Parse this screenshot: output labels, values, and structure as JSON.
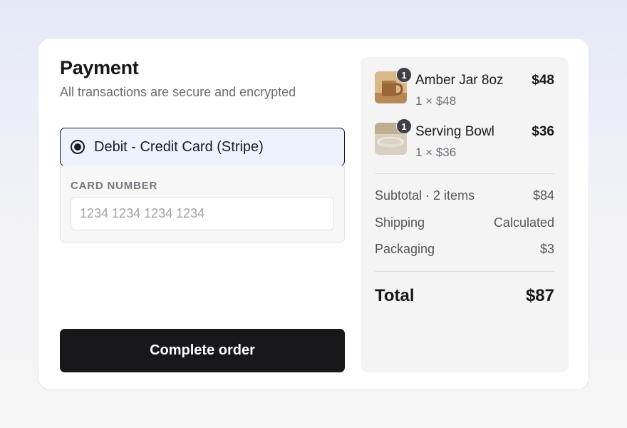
{
  "payment": {
    "title": "Payment",
    "subtitle": "All transactions are secure and encrypted",
    "method_label": "Debit - Credit Card (Stripe)",
    "card_number_label": "CARD NUMBER",
    "card_number_placeholder": "1234 1234 1234 1234",
    "card_number_value": "",
    "complete_button": "Complete order"
  },
  "summary": {
    "items": [
      {
        "name": "Amber Jar 8oz",
        "qty_badge": "1",
        "meta": "1 × $48",
        "price": "$48",
        "thumb_icon": "amber-jar-thumbnail"
      },
      {
        "name": "Serving Bowl",
        "qty_badge": "1",
        "meta": "1 × $36",
        "price": "$36",
        "thumb_icon": "serving-bowl-thumbnail"
      }
    ],
    "subtotal_label": "Subtotal · 2 items",
    "subtotal_value": "$84",
    "shipping_label": "Shipping",
    "shipping_value": "Calculated",
    "packaging_label": "Packaging",
    "packaging_value": "$3",
    "total_label": "Total",
    "total_value": "$87"
  },
  "colors": {
    "primary_button": "#18181b",
    "selected_method_bg": "#eef2fd",
    "summary_bg": "#f4f4f5"
  }
}
